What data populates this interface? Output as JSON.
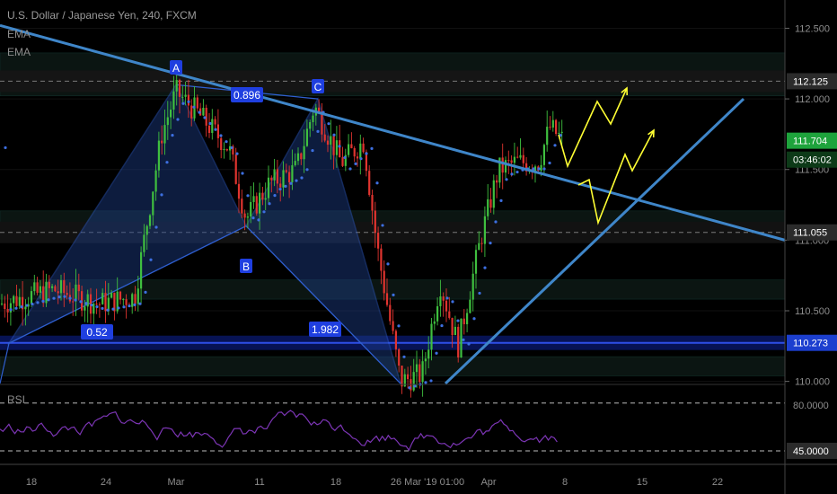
{
  "header": {
    "symbol_line": "U.S. Dollar / Japanese Yen, 240, FXCM",
    "indicator_1": "EMA",
    "indicator_2": "EMA"
  },
  "rsi": {
    "label": "RSI",
    "upper": 80,
    "lower": 45,
    "upper_label": "80.0000",
    "lower_label": "45.0000"
  },
  "colors": {
    "background": "#000000",
    "bull": "#3fbf3f",
    "bear": "#e0342f",
    "trendline": "#3f86c9",
    "pattern": "#2f5fd0",
    "ema_dots": "#3d6fe0",
    "arrows": "#ffff33",
    "rsi_line": "#7c35b5"
  },
  "price_axis": {
    "ticks": [
      {
        "label": "112.500",
        "value": 112.5
      },
      {
        "label": "112.000",
        "value": 112.0
      },
      {
        "label": "111.500",
        "value": 111.5
      },
      {
        "label": "111.000",
        "value": 111.0
      },
      {
        "label": "110.500",
        "value": 110.5
      },
      {
        "label": "110.000",
        "value": 110.0
      }
    ],
    "markers": [
      {
        "label": "112.125",
        "value": 112.125,
        "color": "#2b2b2b"
      },
      {
        "label": "111.704",
        "value": 111.704,
        "color": "#1ea33c"
      },
      {
        "label": "03:46:02",
        "value": 111.57,
        "color": "#0d3a18"
      },
      {
        "label": "111.055",
        "value": 111.055,
        "color": "#2b2b2b"
      },
      {
        "label": "110.273",
        "value": 110.273,
        "color": "#1c3fcf"
      }
    ]
  },
  "time_axis": {
    "labels": [
      "18",
      "24",
      "Mar",
      "11",
      "18",
      "26 Mar '19  01:00",
      "Apr",
      "8",
      "15",
      "22"
    ]
  },
  "chart_data": {
    "type": "candlestick",
    "title": "U.S. Dollar / Japanese Yen, 240, FXCM",
    "ylim": [
      109.985,
      112.7
    ],
    "levels": [
      {
        "label": "112.125",
        "value": 112.125,
        "style": "dashed"
      },
      {
        "label": "111.055",
        "value": 111.055,
        "style": "dashed"
      },
      {
        "label": "110.273",
        "value": 110.273,
        "style": "solid-blue"
      }
    ],
    "pattern_points": [
      {
        "label": "A",
        "price": 112.1
      },
      {
        "label": "B",
        "price": 111.1
      },
      {
        "label": "C",
        "price": 112.0
      }
    ],
    "ratios": [
      "0.896",
      "0.52",
      "1.982"
    ],
    "last_price": 111.704,
    "countdown": "03:46:02"
  }
}
